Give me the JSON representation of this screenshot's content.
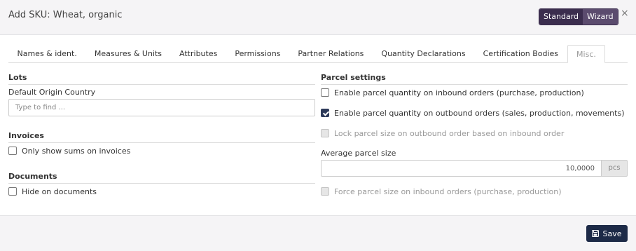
{
  "dialog": {
    "title": "Add SKU: Wheat, organic",
    "close_glyph": "×",
    "mode_toggle": {
      "standard": "Standard",
      "wizard": "Wizard",
      "active": "wizard"
    }
  },
  "tabs": [
    {
      "label": "Names & ident.",
      "active": false
    },
    {
      "label": "Measures & Units",
      "active": false
    },
    {
      "label": "Attributes",
      "active": false
    },
    {
      "label": "Permissions",
      "active": false
    },
    {
      "label": "Partner Relations",
      "active": false
    },
    {
      "label": "Quantity Declarations",
      "active": false
    },
    {
      "label": "Certification Bodies",
      "active": false
    },
    {
      "label": "Misc.",
      "active": true
    }
  ],
  "lots": {
    "title": "Lots",
    "origin_label": "Default Origin Country",
    "origin_placeholder": "Type to find ...",
    "origin_value": ""
  },
  "invoices": {
    "title": "Invoices",
    "only_sums": {
      "label": "Only show sums on invoices",
      "checked": false
    }
  },
  "documents": {
    "title": "Documents",
    "hide": {
      "label": "Hide on documents",
      "checked": false
    }
  },
  "parcel": {
    "title": "Parcel settings",
    "inbound": {
      "label": "Enable parcel quantity on inbound orders (purchase, production)",
      "checked": false,
      "disabled": false
    },
    "outbound": {
      "label": "Enable parcel quantity on outbound orders (sales, production, movements)",
      "checked": true,
      "disabled": false
    },
    "lock": {
      "label": "Lock parcel size on outbound order based on inbound order",
      "checked": false,
      "disabled": true
    },
    "avg_label": "Average parcel size",
    "avg_value": "10,0000",
    "avg_unit": "pcs",
    "force": {
      "label": "Force parcel size on inbound orders (purchase, production)",
      "checked": false,
      "disabled": true
    }
  },
  "footer": {
    "save_label": "Save",
    "save_icon": "floppy-disk-icon"
  },
  "colors": {
    "primary": "#1d2a47",
    "toggle_bg": "#3b2d4e",
    "toggle_active": "#5b4b6e",
    "check_active": "#2d3a5a"
  }
}
